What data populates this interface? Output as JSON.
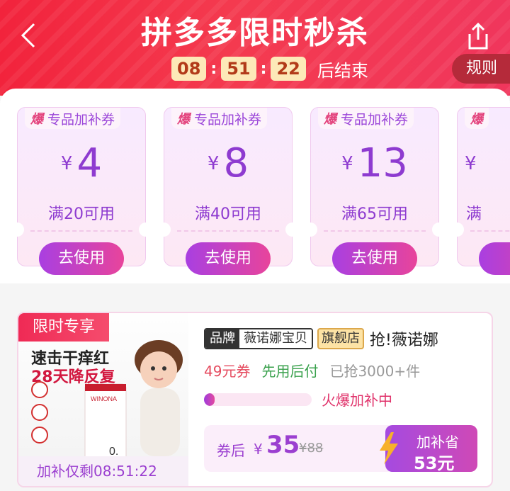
{
  "header": {
    "title": "拼多多限时秒杀",
    "timer": {
      "h": "08",
      "m": "51",
      "s": "22",
      "suffix": "后结束"
    },
    "rules_label": "规则"
  },
  "coupons": [
    {
      "tag_icon": "爆",
      "tag_label": "专品加补券",
      "currency": "¥",
      "amount": "4",
      "condition": "满20可用",
      "button": "去使用"
    },
    {
      "tag_icon": "爆",
      "tag_label": "专品加补券",
      "currency": "¥",
      "amount": "8",
      "condition": "满40可用",
      "button": "去使用"
    },
    {
      "tag_icon": "爆",
      "tag_label": "专品加补券",
      "currency": "¥",
      "amount": "13",
      "condition": "满65可用",
      "button": "去使用"
    },
    {
      "tag_icon": "爆",
      "tag_label": "",
      "currency": "¥",
      "amount": "",
      "condition": "满",
      "button": ""
    }
  ],
  "product": {
    "ribbon": "限时专享",
    "promo_line1": "速击干痒红",
    "promo_line2": "28天降反复",
    "remaining": "加补仅剩08:51:22",
    "brand_label": "品牌",
    "brand_name": "薇诺娜宝贝",
    "flagship": "旗舰店",
    "name": "抢!薇诺娜",
    "coupon_text": "49元券",
    "pay_later": "先用后付",
    "sold": "已抢3000+件",
    "progress_fraction": 0.1,
    "progress_text": "火爆加补中",
    "price_label": "券后",
    "price_currency": "¥",
    "price": "35",
    "original_price": "¥88",
    "save_label": "加补省",
    "save_amount": "53元"
  },
  "colors": {
    "header_red": "#f2233c",
    "accent_purple": "#8e3bd0",
    "button_gradient_start": "#a93fe1",
    "button_gradient_end": "#e8449b"
  },
  "icons": [
    "back-chevron-icon",
    "share-icon",
    "lightning-icon"
  ]
}
